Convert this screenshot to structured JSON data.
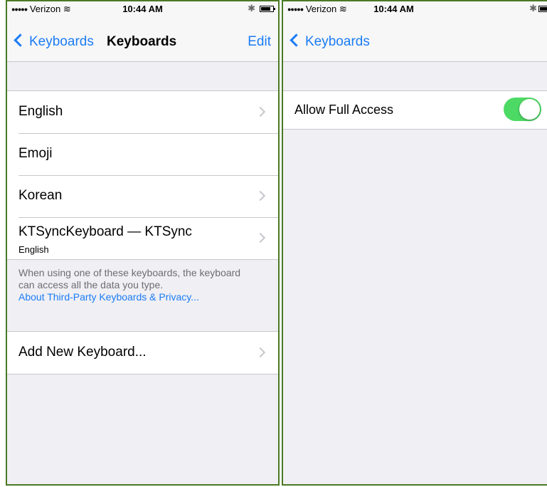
{
  "left": {
    "status": {
      "carrier": "Verizon",
      "time": "10:44 AM"
    },
    "nav": {
      "back": "Keyboards",
      "title": "Keyboards",
      "edit": "Edit"
    },
    "keyboards": [
      {
        "label": "English",
        "sub": "",
        "chevron": true
      },
      {
        "label": "Emoji",
        "sub": "",
        "chevron": false
      },
      {
        "label": "Korean",
        "sub": "",
        "chevron": true
      },
      {
        "label": "KTSyncKeyboard — KTSync",
        "sub": "English",
        "chevron": true
      }
    ],
    "footnote": {
      "text": "When using one of these keyboards, the keyboard can access all the data you type.",
      "link": "About Third-Party Keyboards & Privacy..."
    },
    "add": {
      "label": "Add New Keyboard..."
    }
  },
  "right": {
    "status": {
      "carrier": "Verizon",
      "time": "10:44 AM"
    },
    "nav": {
      "back": "Keyboards"
    },
    "full_access": {
      "label": "Allow Full Access",
      "on": true
    }
  },
  "colors": {
    "accent": "#1b7cf5",
    "toggle_on": "#4cd964",
    "frame": "#4a7a24"
  }
}
